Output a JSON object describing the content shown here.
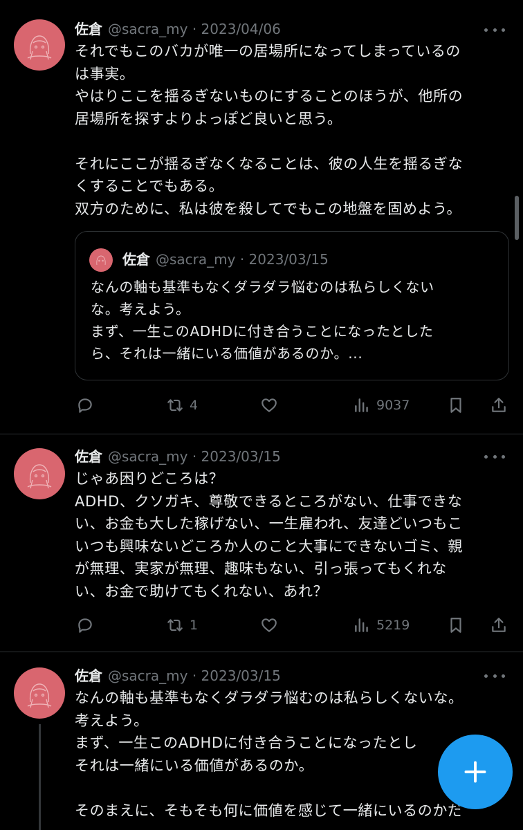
{
  "tweets": [
    {
      "name": "佐倉",
      "handle": "@sacra_my",
      "date": "· 2023/04/06",
      "text": "それでもこのバカが唯一の居場所になってしまっているの\nは事実。\nやはりここを揺るぎないものにすることのほうが、他所の\n居場所を探すよりよっぽど良いと思う。\n\nそれにここが揺るぎなくなることは、彼の人生を揺るぎな\nくすることでもある。\n双方のために、私は彼を殺してでもこの地盤を固めよう。",
      "quote": {
        "name": "佐倉",
        "handle": "@sacra_my",
        "date": "· 2023/03/15",
        "text": "なんの軸も基準もなくダラダラ悩むのは私らしくない\nな。考えよう。\nまず、一生このADHDに付き合うことになったとした\nら、それは一緒にいる価値があるのか。..."
      },
      "retweets": "4",
      "views": "9037"
    },
    {
      "name": "佐倉",
      "handle": "@sacra_my",
      "date": "· 2023/03/15",
      "text": "じゃあ困りどころは？\nADHD、クソガキ、尊敬できるところがない、仕事できな\nい、お金も大した稼げない、一生雇われ、友達どいつもこ\nいつも興味ないどころか人のこと大事にできないゴミ、親\nが無理、実家が無理、趣味もない、引っ張ってもくれな\nい、お金で助けてもくれない、あれ？",
      "retweets": "1",
      "views": "5219"
    },
    {
      "name": "佐倉",
      "handle": "@sacra_my",
      "date": "· 2023/03/15",
      "text": "なんの軸も基準もなくダラダラ悩むのは私らしくないな。\n考えよう。\nまず、一生このADHDに付き合うことになったとし\nそれは一緒にいる価値があるのか。\n\nそのまえに、そもそも何に価値を感じて一緒にいるのかだ"
    }
  ],
  "colors": {
    "background": "#000000",
    "text": "#e7e9ea",
    "secondary": "#71767b",
    "avatar": "#d9666f",
    "accent": "#1d9bf0"
  },
  "icons": {
    "reply": "reply-icon",
    "retweet": "retweet-icon",
    "like": "heart-icon",
    "views": "views-icon",
    "bookmark": "bookmark-icon",
    "share": "share-icon",
    "more": "more-icon",
    "compose": "plus-icon"
  }
}
